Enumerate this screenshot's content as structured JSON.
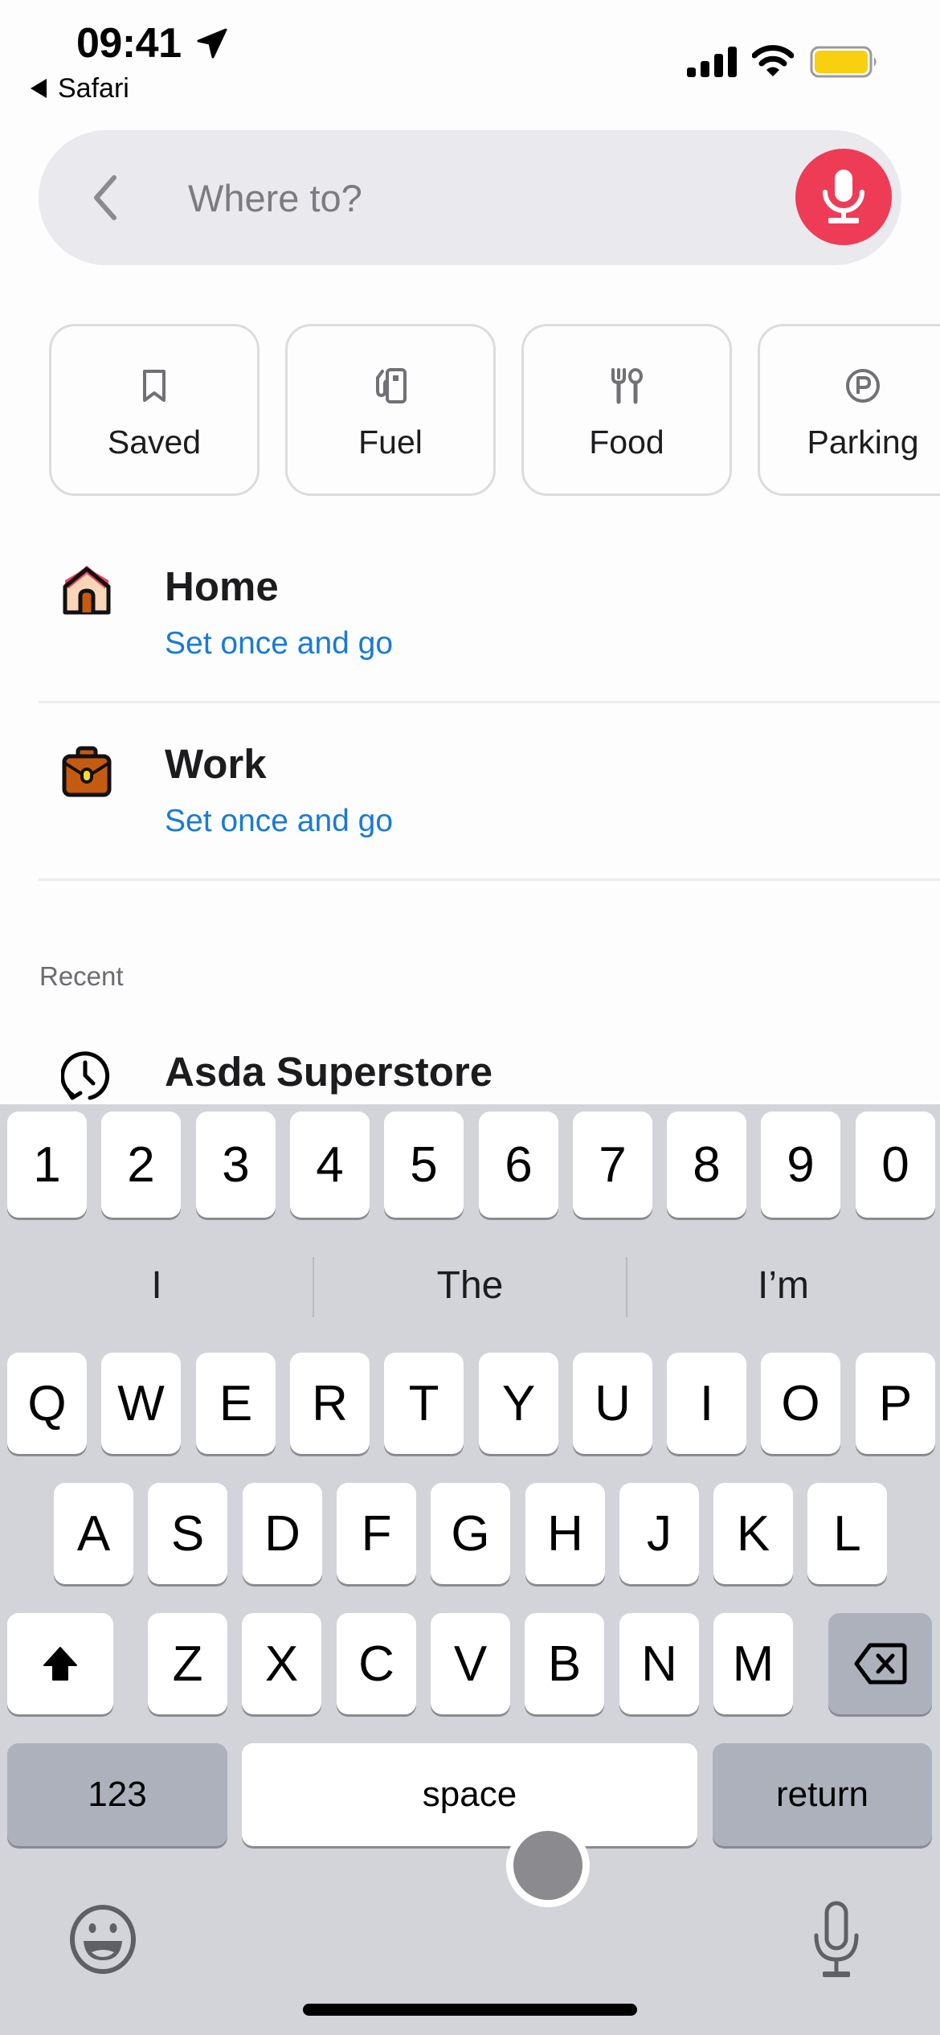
{
  "status_bar": {
    "time": "09:41",
    "back_app": "Safari",
    "battery_color": "#f8d00f",
    "icons": [
      "location-arrow-icon",
      "signal-icon",
      "wifi-icon",
      "battery-icon"
    ]
  },
  "search": {
    "placeholder": "Where to?",
    "value": "",
    "back_icon": "chevron-left-icon",
    "voice_icon": "microphone-icon",
    "voice_color": "#ee3c56"
  },
  "categories": [
    {
      "label": "Saved",
      "icon": "bookmark-icon"
    },
    {
      "label": "Fuel",
      "icon": "fuel-pump-icon"
    },
    {
      "label": "Food",
      "icon": "fork-spoon-icon"
    },
    {
      "label": "Parking",
      "icon": "parking-icon"
    }
  ],
  "places": [
    {
      "title": "Home",
      "subtitle": "Set once and go",
      "icon": "house-icon"
    },
    {
      "title": "Work",
      "subtitle": "Set once and go",
      "icon": "briefcase-icon"
    }
  ],
  "recent": {
    "label": "Recent",
    "items": [
      {
        "title": "Asda Superstore",
        "icon": "history-clock-icon"
      }
    ]
  },
  "keyboard": {
    "suggestions": [
      "I",
      "The",
      "I’m"
    ],
    "number_row": [
      "1",
      "2",
      "3",
      "4",
      "5",
      "6",
      "7",
      "8",
      "9",
      "0"
    ],
    "row1": [
      "Q",
      "W",
      "E",
      "R",
      "T",
      "Y",
      "U",
      "I",
      "O",
      "P"
    ],
    "row2": [
      "A",
      "S",
      "D",
      "F",
      "G",
      "H",
      "J",
      "K",
      "L"
    ],
    "row3": [
      "Z",
      "X",
      "C",
      "V",
      "B",
      "N",
      "M"
    ],
    "numbers_key": "123",
    "space_key": "space",
    "return_key": "return"
  }
}
